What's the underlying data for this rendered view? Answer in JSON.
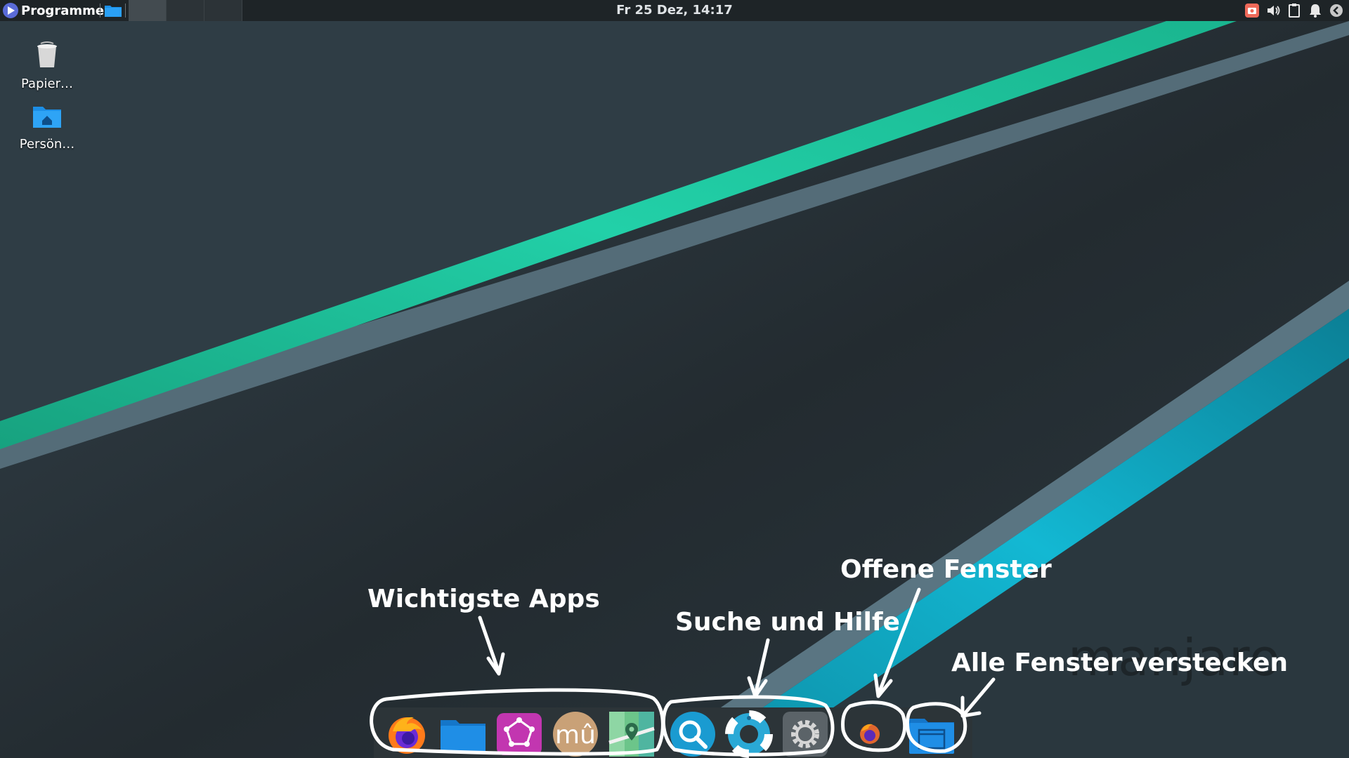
{
  "panel": {
    "menu_label": "Programme",
    "clock": "Fr 25 Dez, 14:17",
    "workspaces": [
      "1",
      "2",
      "3"
    ],
    "active_workspace": 1,
    "tray": [
      "screenshot-icon",
      "volume-icon",
      "clipboard-icon",
      "notification-bell-icon",
      "power-icon"
    ]
  },
  "desktop": {
    "icons": [
      {
        "label": "Papier…",
        "icon": "trash-icon"
      },
      {
        "label": "Persön…",
        "icon": "home-folder-icon"
      }
    ],
    "watermark": "manjaro"
  },
  "dock": {
    "apps": [
      "firefox-icon",
      "files-icon",
      "gnome-software-icon",
      "musescore-icon",
      "maps-icon"
    ],
    "tools": [
      "search-icon",
      "help-icon",
      "settings-icon"
    ],
    "open_windows": [
      "firefox-window-icon"
    ],
    "show_desktop": "show-desktop-icon"
  },
  "annotations": {
    "apps": "Wichtigste Apps",
    "search_help": "Suche und Hilfe",
    "open_windows": "Offene Fenster",
    "hide_all": "Alle Fenster verstecken"
  },
  "colors": {
    "panel_bg": "#1e2427",
    "wallpaper_dark": "#232b30",
    "stripe_green": "#1fbf9a",
    "stripe_cyan": "#0fa7c0",
    "stripe_gray": "#5a7380"
  }
}
